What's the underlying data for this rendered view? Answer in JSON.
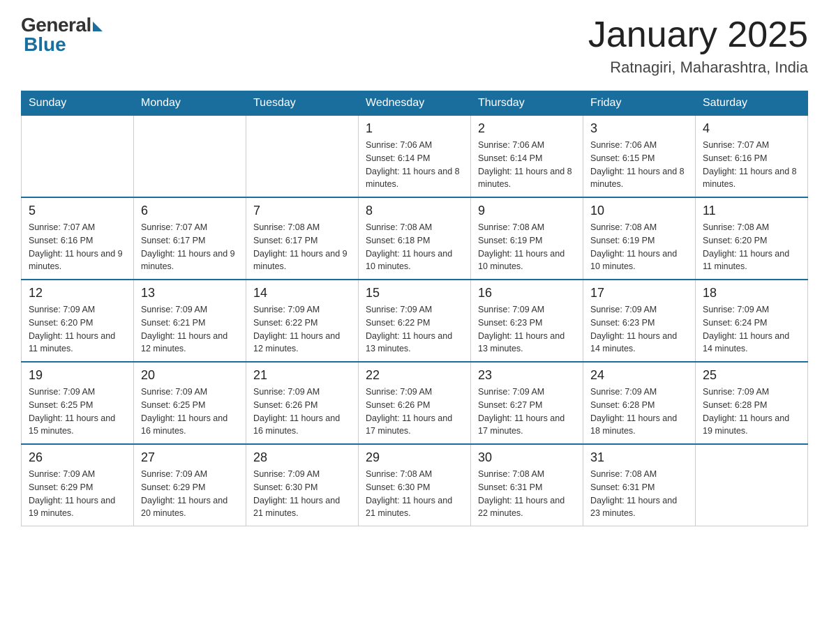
{
  "header": {
    "logo_general": "General",
    "logo_blue": "Blue",
    "title": "January 2025",
    "location": "Ratnagiri, Maharashtra, India"
  },
  "days_of_week": [
    "Sunday",
    "Monday",
    "Tuesday",
    "Wednesday",
    "Thursday",
    "Friday",
    "Saturday"
  ],
  "weeks": [
    [
      {
        "day": "",
        "info": ""
      },
      {
        "day": "",
        "info": ""
      },
      {
        "day": "",
        "info": ""
      },
      {
        "day": "1",
        "info": "Sunrise: 7:06 AM\nSunset: 6:14 PM\nDaylight: 11 hours and 8 minutes."
      },
      {
        "day": "2",
        "info": "Sunrise: 7:06 AM\nSunset: 6:14 PM\nDaylight: 11 hours and 8 minutes."
      },
      {
        "day": "3",
        "info": "Sunrise: 7:06 AM\nSunset: 6:15 PM\nDaylight: 11 hours and 8 minutes."
      },
      {
        "day": "4",
        "info": "Sunrise: 7:07 AM\nSunset: 6:16 PM\nDaylight: 11 hours and 8 minutes."
      }
    ],
    [
      {
        "day": "5",
        "info": "Sunrise: 7:07 AM\nSunset: 6:16 PM\nDaylight: 11 hours and 9 minutes."
      },
      {
        "day": "6",
        "info": "Sunrise: 7:07 AM\nSunset: 6:17 PM\nDaylight: 11 hours and 9 minutes."
      },
      {
        "day": "7",
        "info": "Sunrise: 7:08 AM\nSunset: 6:17 PM\nDaylight: 11 hours and 9 minutes."
      },
      {
        "day": "8",
        "info": "Sunrise: 7:08 AM\nSunset: 6:18 PM\nDaylight: 11 hours and 10 minutes."
      },
      {
        "day": "9",
        "info": "Sunrise: 7:08 AM\nSunset: 6:19 PM\nDaylight: 11 hours and 10 minutes."
      },
      {
        "day": "10",
        "info": "Sunrise: 7:08 AM\nSunset: 6:19 PM\nDaylight: 11 hours and 10 minutes."
      },
      {
        "day": "11",
        "info": "Sunrise: 7:08 AM\nSunset: 6:20 PM\nDaylight: 11 hours and 11 minutes."
      }
    ],
    [
      {
        "day": "12",
        "info": "Sunrise: 7:09 AM\nSunset: 6:20 PM\nDaylight: 11 hours and 11 minutes."
      },
      {
        "day": "13",
        "info": "Sunrise: 7:09 AM\nSunset: 6:21 PM\nDaylight: 11 hours and 12 minutes."
      },
      {
        "day": "14",
        "info": "Sunrise: 7:09 AM\nSunset: 6:22 PM\nDaylight: 11 hours and 12 minutes."
      },
      {
        "day": "15",
        "info": "Sunrise: 7:09 AM\nSunset: 6:22 PM\nDaylight: 11 hours and 13 minutes."
      },
      {
        "day": "16",
        "info": "Sunrise: 7:09 AM\nSunset: 6:23 PM\nDaylight: 11 hours and 13 minutes."
      },
      {
        "day": "17",
        "info": "Sunrise: 7:09 AM\nSunset: 6:23 PM\nDaylight: 11 hours and 14 minutes."
      },
      {
        "day": "18",
        "info": "Sunrise: 7:09 AM\nSunset: 6:24 PM\nDaylight: 11 hours and 14 minutes."
      }
    ],
    [
      {
        "day": "19",
        "info": "Sunrise: 7:09 AM\nSunset: 6:25 PM\nDaylight: 11 hours and 15 minutes."
      },
      {
        "day": "20",
        "info": "Sunrise: 7:09 AM\nSunset: 6:25 PM\nDaylight: 11 hours and 16 minutes."
      },
      {
        "day": "21",
        "info": "Sunrise: 7:09 AM\nSunset: 6:26 PM\nDaylight: 11 hours and 16 minutes."
      },
      {
        "day": "22",
        "info": "Sunrise: 7:09 AM\nSunset: 6:26 PM\nDaylight: 11 hours and 17 minutes."
      },
      {
        "day": "23",
        "info": "Sunrise: 7:09 AM\nSunset: 6:27 PM\nDaylight: 11 hours and 17 minutes."
      },
      {
        "day": "24",
        "info": "Sunrise: 7:09 AM\nSunset: 6:28 PM\nDaylight: 11 hours and 18 minutes."
      },
      {
        "day": "25",
        "info": "Sunrise: 7:09 AM\nSunset: 6:28 PM\nDaylight: 11 hours and 19 minutes."
      }
    ],
    [
      {
        "day": "26",
        "info": "Sunrise: 7:09 AM\nSunset: 6:29 PM\nDaylight: 11 hours and 19 minutes."
      },
      {
        "day": "27",
        "info": "Sunrise: 7:09 AM\nSunset: 6:29 PM\nDaylight: 11 hours and 20 minutes."
      },
      {
        "day": "28",
        "info": "Sunrise: 7:09 AM\nSunset: 6:30 PM\nDaylight: 11 hours and 21 minutes."
      },
      {
        "day": "29",
        "info": "Sunrise: 7:08 AM\nSunset: 6:30 PM\nDaylight: 11 hours and 21 minutes."
      },
      {
        "day": "30",
        "info": "Sunrise: 7:08 AM\nSunset: 6:31 PM\nDaylight: 11 hours and 22 minutes."
      },
      {
        "day": "31",
        "info": "Sunrise: 7:08 AM\nSunset: 6:31 PM\nDaylight: 11 hours and 23 minutes."
      },
      {
        "day": "",
        "info": ""
      }
    ]
  ]
}
